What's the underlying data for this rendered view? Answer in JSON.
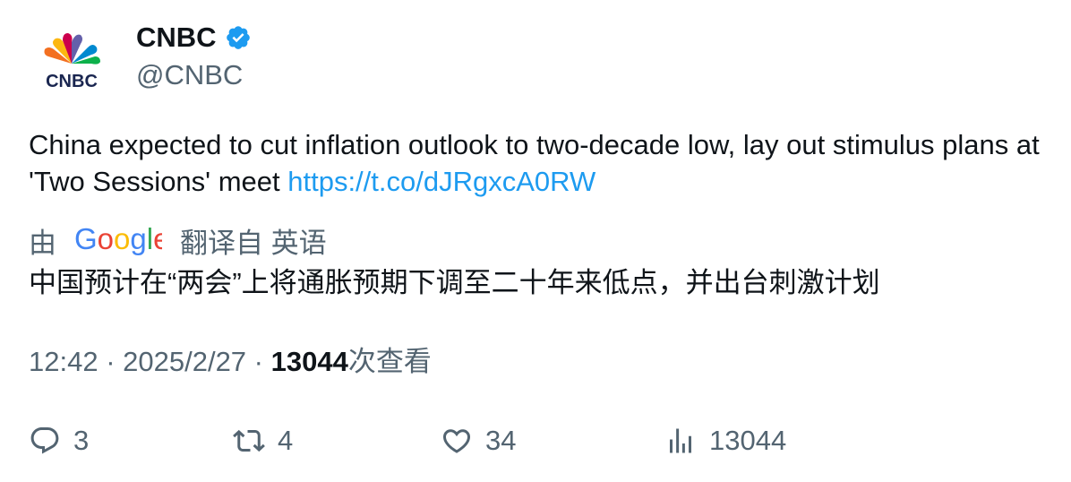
{
  "author": {
    "display_name": "CNBC",
    "handle": "@CNBC",
    "avatar_icon": "cnbc-peacock-logo",
    "avatar_text": "CNBC",
    "verified_icon": "verified-badge-icon",
    "verified_color": "#1d9bf0"
  },
  "tweet": {
    "text": "China expected to cut inflation outlook to two-decade low, lay out stimulus plans at 'Two Sessions' meet ",
    "link": "https://t.co/dJRgxcA0RW",
    "link_color": "#1d9bf0"
  },
  "translation": {
    "prefix": "由",
    "provider_logo": "google-logo",
    "suffix": "翻译自 英语",
    "text": "中国预计在“两会”上将通胀预期下调至二十年来低点，并出台刺激计划"
  },
  "meta": {
    "time": "12:42",
    "separator": " · ",
    "date": "2025/2/27",
    "separator2": " · ",
    "views_count": "13044",
    "views_label": "次查看"
  },
  "actions": {
    "reply": {
      "icon": "reply-icon",
      "count": "3"
    },
    "retweet": {
      "icon": "retweet-icon",
      "count": "4"
    },
    "like": {
      "icon": "heart-icon",
      "count": "34"
    },
    "views": {
      "icon": "analytics-icon",
      "count": "13044"
    }
  },
  "colors": {
    "text_primary": "#0f1419",
    "text_secondary": "#536471",
    "accent": "#1d9bf0"
  }
}
